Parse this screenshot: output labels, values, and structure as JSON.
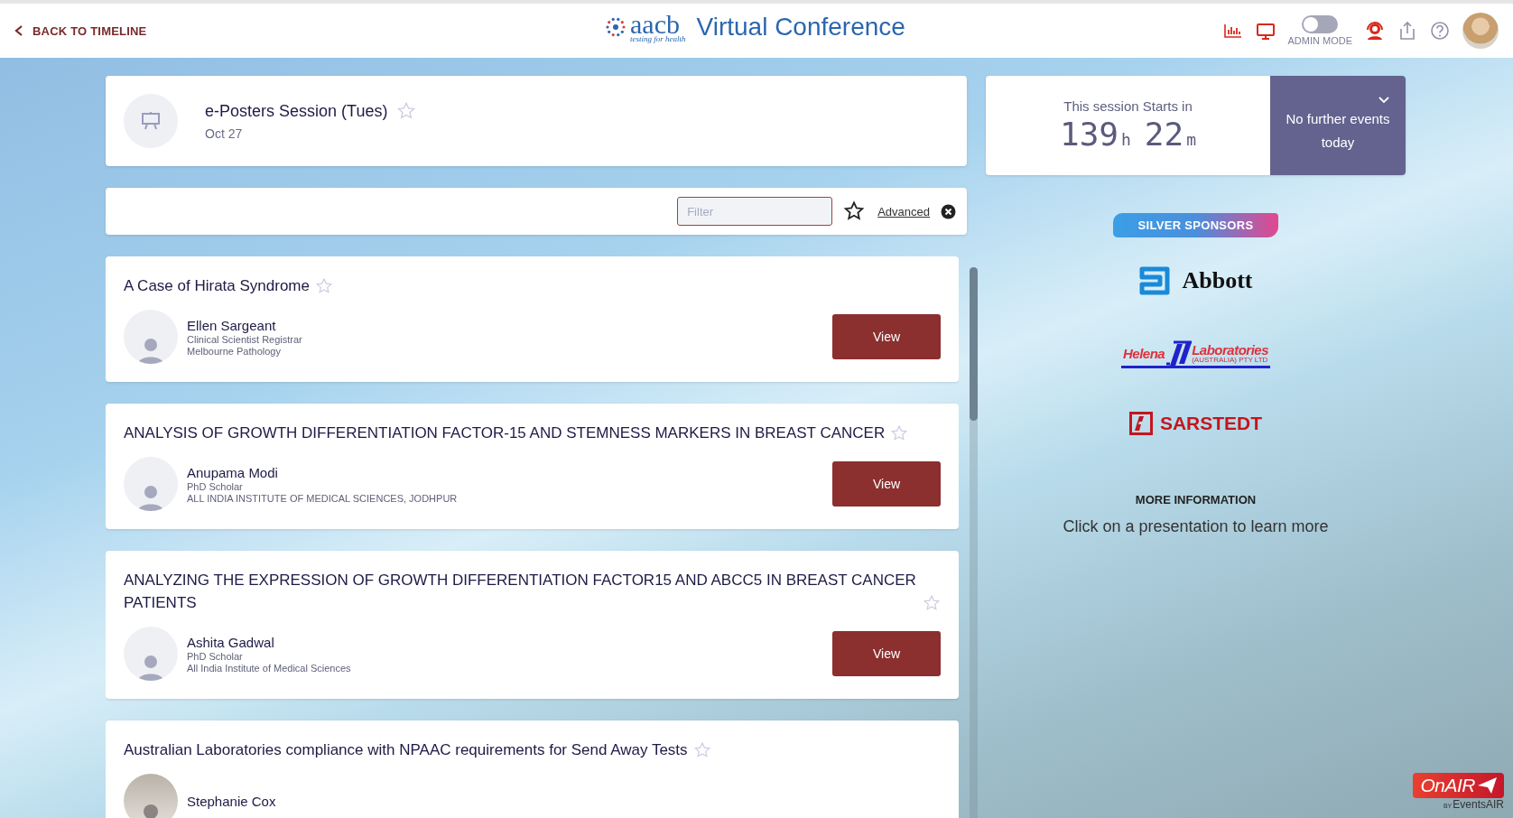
{
  "header": {
    "back_link": "BACK TO TIMELINE",
    "logo": {
      "name": "aacb",
      "tagline": "testing for health"
    },
    "title": "Virtual Conference",
    "admin_mode": {
      "label": "ADMIN MODE",
      "on": false
    }
  },
  "session": {
    "title": "e-Posters Session (Tues)",
    "date": "Oct 27",
    "favorite": false
  },
  "filter": {
    "placeholder": "Filter",
    "favorites_only": false,
    "advanced": "Advanced"
  },
  "presentations": [
    {
      "title": "A Case of Hirata Syndrome",
      "favorite": false,
      "presenter": {
        "name": "Ellen Sargeant",
        "role": "Clinical Scientist Registrar",
        "affiliation": "Melbourne Pathology"
      },
      "button": {
        "label": "View"
      }
    },
    {
      "title": "ANALYSIS OF GROWTH DIFFERENTIATION FACTOR-15 AND STEMNESS MARKERS IN BREAST CANCER",
      "favorite": false,
      "presenter": {
        "name": "Anupama Modi",
        "role": "PhD Scholar",
        "affiliation": "ALL INDIA INSTITUTE OF MEDICAL SCIENCES, JODHPUR"
      },
      "button": {
        "label": "View"
      }
    },
    {
      "title": "ANALYZING THE EXPRESSION OF GROWTH DIFFERENTIATION FACTOR15 AND ABCC5 IN BREAST CANCER PATIENTS",
      "favorite": false,
      "presenter": {
        "name": "Ashita Gadwal",
        "role": "PhD Scholar",
        "affiliation": "All India Institute of Medical Sciences"
      },
      "button": {
        "label": "View"
      }
    },
    {
      "title": "Australian Laboratories compliance with NPAAC requirements for Send Away Tests",
      "favorite": false,
      "presenter": {
        "name": "Stephanie Cox",
        "photo": true
      }
    }
  ],
  "countdown": {
    "label": "This session Starts in",
    "hours": "139",
    "hours_unit": "h",
    "minutes": "22",
    "minutes_unit": "m"
  },
  "next_events": {
    "text": "No further events today"
  },
  "sponsors": {
    "heading": "SILVER SPONSORS",
    "items": [
      {
        "kind": "abbott",
        "name": "Abbott"
      },
      {
        "kind": "helena",
        "name": "Helena",
        "name2": "Laboratories",
        "sub": "(AUSTRALIA) PTY LTD"
      },
      {
        "kind": "sarstedt",
        "name": "SARSTEDT"
      }
    ]
  },
  "more_info": {
    "heading": "MORE INFORMATION",
    "text": "Click on a presentation to learn more"
  },
  "badge": {
    "name": "OnAIR",
    "by": "BY",
    "product": "EventsAIR"
  }
}
